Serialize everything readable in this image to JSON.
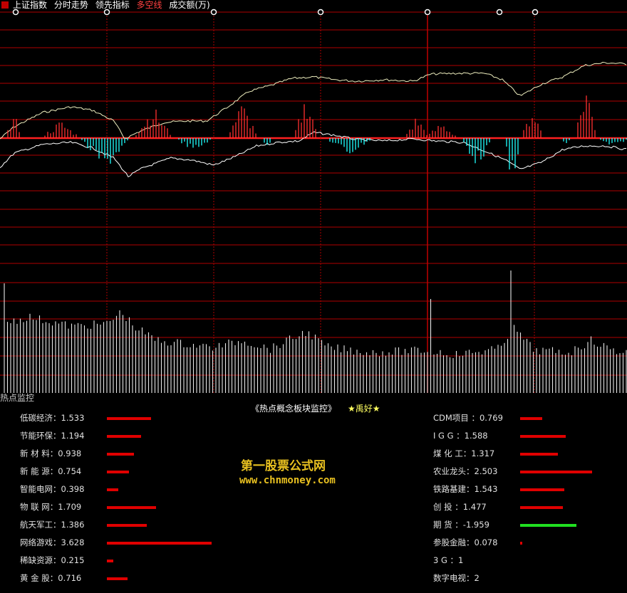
{
  "toolbar": {
    "index_name": "上证指数",
    "tabs": [
      "分时走势",
      "领先指标",
      "多空线",
      "成交额(万)"
    ],
    "active_tab": "多空线"
  },
  "panel": {
    "title": "热点监控",
    "header": "《热点概念板块监控》",
    "author": "★禹好★"
  },
  "left_rows": [
    {
      "label": "低碳经济",
      "value": 1.533,
      "text": "1.533"
    },
    {
      "label": "节能环保",
      "value": 1.194,
      "text": "1.194"
    },
    {
      "label": "新 材 料",
      "value": 0.938,
      "text": "0.938"
    },
    {
      "label": "新 能 源",
      "value": 0.754,
      "text": "0.754"
    },
    {
      "label": "智能电网",
      "value": 0.398,
      "text": "0.398"
    },
    {
      "label": "物 联 网",
      "value": 1.709,
      "text": "1.709"
    },
    {
      "label": "航天军工",
      "value": 1.386,
      "text": "1.386"
    },
    {
      "label": "网络游戏",
      "value": 3.628,
      "text": "3.628"
    },
    {
      "label": "稀缺资源",
      "value": 0.215,
      "text": "0.215"
    },
    {
      "label": "黄 金 股",
      "value": 0.716,
      "text": "0.716"
    }
  ],
  "right_rows": [
    {
      "label": "CDM项目 ",
      "value": 0.769,
      "text": "0.769",
      "bar": true
    },
    {
      "label": " I G G ",
      "value": 1.588,
      "text": "1.588",
      "bar": true
    },
    {
      "label": " 煤 化 工",
      "value": 1.317,
      "text": "1.317",
      "bar": true
    },
    {
      "label": "农业龙头",
      "value": 2.503,
      "text": "2.503",
      "bar": true
    },
    {
      "label": "铁路基建",
      "value": 1.543,
      "text": "1.543",
      "bar": true
    },
    {
      "label": " 创  投 ",
      "value": 1.477,
      "text": "1.477",
      "bar": true
    },
    {
      "label": " 期  货 ",
      "value": -1.959,
      "text": "-1.959",
      "bar": true
    },
    {
      "label": "参股金融",
      "value": 0.078,
      "text": "0.078",
      "bar": true
    },
    {
      "label": " 3 G ",
      "value": 1,
      "text": "1",
      "bar": false
    },
    {
      "label": "数字电视",
      "value": 2,
      "text": "2",
      "bar": false
    }
  ],
  "watermark": {
    "name": "第一股票公式网",
    "url": "www.chnmoney.com"
  },
  "colors": {
    "grid": "#b00000",
    "up": "#ff3030",
    "down": "#20ffff",
    "positive_bar": "#e00000",
    "negative_bar": "#20e020",
    "line": "#f0f0c0",
    "watermark": "#e8c020"
  },
  "icons": [
    "event-marker-icon"
  ]
}
